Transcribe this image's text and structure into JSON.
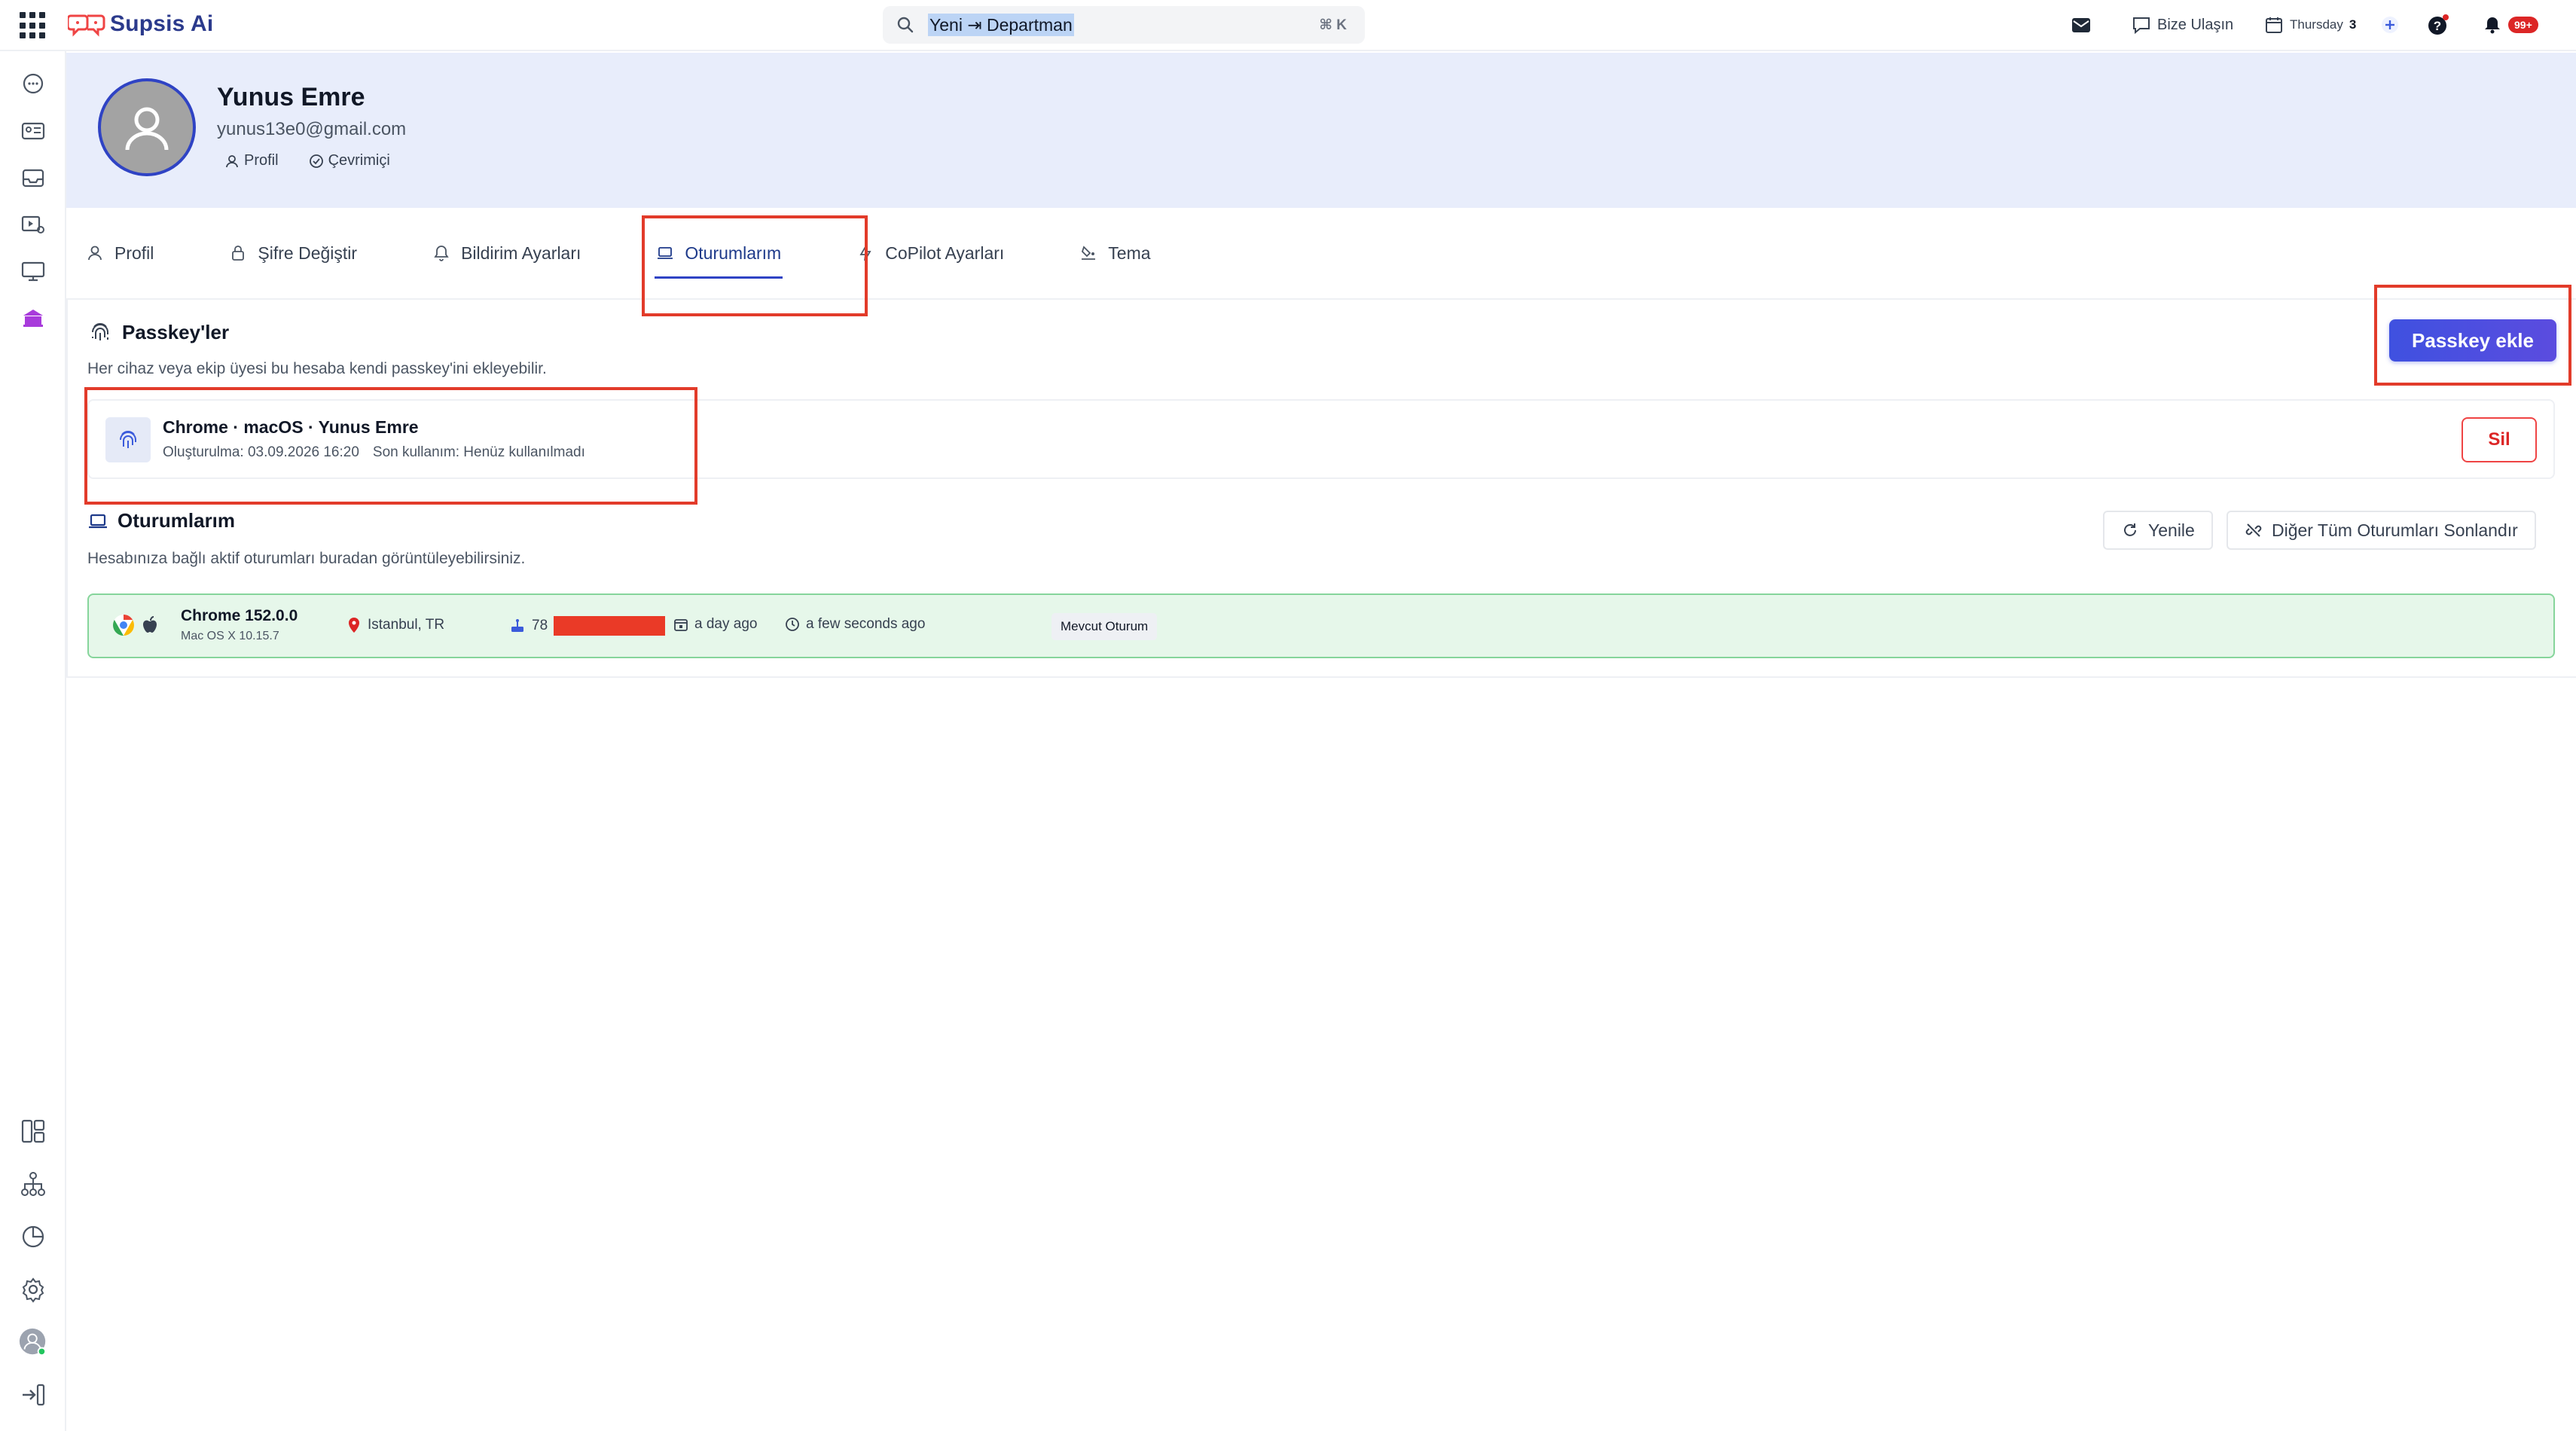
{
  "topbar": {
    "app_name": "Supsis Ai",
    "search_text": "Yeni ⇥ Departman",
    "search_shortcut": "⌘ K",
    "contact_label": "Bize Ulaşın",
    "day_label": "Thursday",
    "day_number": "3",
    "notification_count": "99+"
  },
  "profile": {
    "name": "Yunus Emre",
    "email": "yunus13e0@gmail.com",
    "tag_profile": "Profil",
    "tag_status": "Çevrimiçi"
  },
  "tabs": [
    {
      "label": "Profil"
    },
    {
      "label": "Şifre Değiştir"
    },
    {
      "label": "Bildirim Ayarları"
    },
    {
      "label": "Oturumlarım"
    },
    {
      "label": "CoPilot Ayarları"
    },
    {
      "label": "Tema"
    }
  ],
  "passkeys": {
    "title": "Passkey'ler",
    "description": "Her cihaz veya ekip üyesi bu hesaba kendi passkey'ini ekleyebilir.",
    "add_button": "Passkey ekle",
    "item": {
      "title": "Chrome · macOS · Yunus Emre",
      "created": "Oluşturulma: 03.09.2026 16:20",
      "last_used": "Son kullanım: Henüz kullanılmadı",
      "delete_button": "Sil"
    }
  },
  "sessions": {
    "title": "Oturumlarım",
    "description": "Hesabınıza bağlı aktif oturumları buradan görüntüleyebilirsiniz.",
    "refresh_button": "Yenile",
    "end_all_button": "Diğer Tüm Oturumları Sonlandır",
    "current": {
      "browser": "Chrome 152.0.0",
      "os": "Mac OS X 10.15.7",
      "location": "Istanbul, TR",
      "ip_prefix": "78",
      "created": "a day ago",
      "last_active": "a few seconds ago",
      "badge": "Mevcut Oturum"
    }
  },
  "colors": {
    "accent": "#2f43c4",
    "annotation": "#e23b2a",
    "session_bg": "#e6f7ea",
    "danger": "#dc2626"
  }
}
